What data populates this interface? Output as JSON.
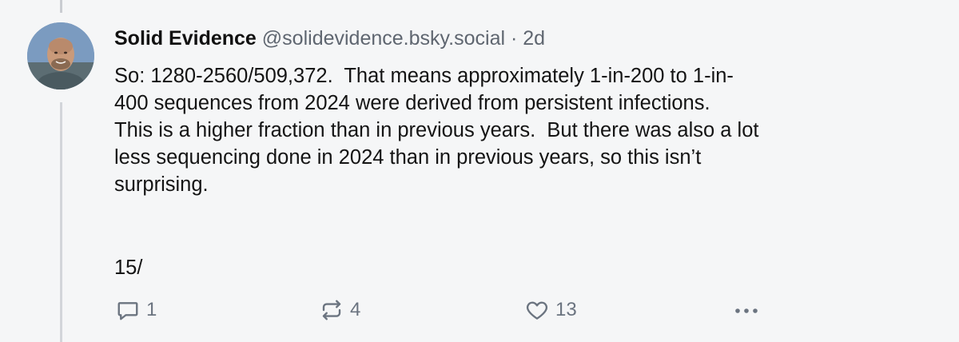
{
  "post": {
    "author_name": "Solid Evidence",
    "handle": "@solidevidence.bsky.social",
    "separator": "·",
    "time": "2d",
    "lines": [
      "So: 1280-2560/509,372.  That means approximately 1-in-200 to 1-in-",
      "400 sequences from 2024 were derived from persistent infections.",
      "This is a higher fraction than in previous years.  But there was also a lot",
      "less sequencing done in 2024 than in previous years, so this isn’t",
      "surprising."
    ],
    "thread_count": "15/"
  },
  "actions": {
    "reply_count": "1",
    "repost_count": "4",
    "like_count": "13"
  },
  "icons": {
    "reply": "reply-icon",
    "repost": "repost-icon",
    "like": "heart-icon",
    "more": "more-icon"
  },
  "colors": {
    "background": "#f5f6f7",
    "text": "#141414",
    "muted": "#6b7480",
    "thread_line": "#c9ccd1"
  }
}
